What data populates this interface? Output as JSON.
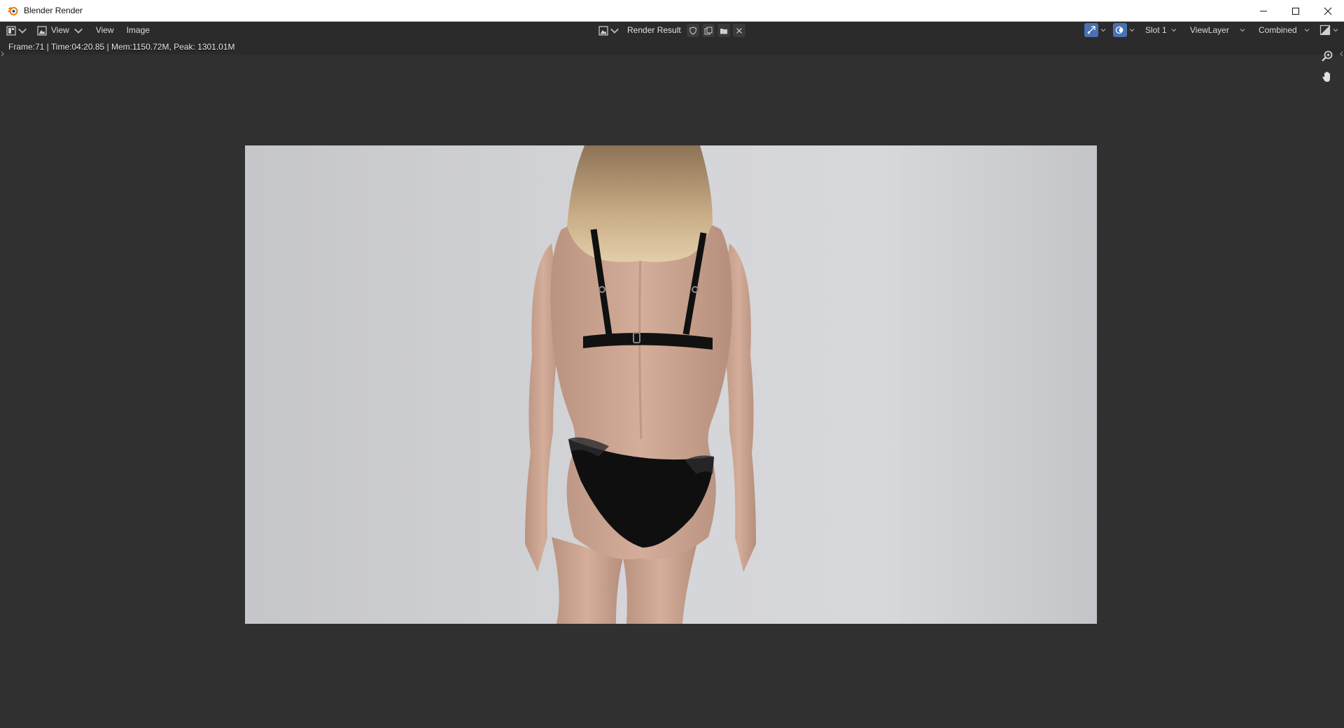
{
  "window": {
    "title": "Blender Render"
  },
  "header": {
    "menus": [
      "View",
      "Image"
    ],
    "view_dropdown_label": "View",
    "image_name": "Render Result",
    "slot": "Slot 1",
    "view_layer": "ViewLayer",
    "pass": "Combined"
  },
  "viewport": {
    "stats": "Frame:71 | Time:04:20.85 | Mem:1150.72M, Peak: 1301.01M"
  },
  "colors": {
    "accent": "#4772b3",
    "background": "#303030",
    "header": "#2b2b2b",
    "blender_orange": "#e87d0d"
  },
  "icons": {
    "app": "blender-logo-icon",
    "editor_type": "image-editor-icon",
    "image_browse": "image-browse-icon",
    "fake_user": "shield-icon",
    "new_image": "duplicate-icon",
    "open_image": "folder-icon",
    "unlink": "close-icon",
    "gizmo": "gizmo-icon",
    "overlay": "overlay-icon",
    "display_channels": "display-channels-icon",
    "zoom": "zoom-icon",
    "pan": "hand-icon"
  }
}
